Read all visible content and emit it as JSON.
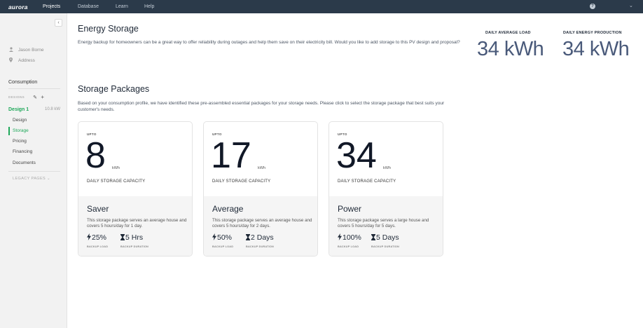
{
  "nav": {
    "logo": "aurora",
    "items": [
      {
        "label": "Projects"
      },
      {
        "label": "Database"
      },
      {
        "label": "Learn"
      },
      {
        "label": "Help"
      }
    ],
    "help_icon_glyph": "?",
    "dropdown_glyph": "⌄"
  },
  "sidebar": {
    "collapse_glyph": "‹",
    "customer_name": "Jason Borne",
    "address": "Address",
    "consumption": "Consumption",
    "designs_label": "DESIGNS",
    "design_name": "Design 1",
    "design_size": "10.8 kW",
    "items": [
      {
        "label": "Design"
      },
      {
        "label": "Storage"
      },
      {
        "label": "Pricing"
      },
      {
        "label": "Financing"
      },
      {
        "label": "Documents"
      }
    ],
    "legacy": "LEGACY PAGES  ⌄",
    "accent_color": "#1fa85a"
  },
  "header": {
    "title": "Energy Storage",
    "description": "Energy backup for homeowners can be a great way to offer reliability during outages and help them save on their electricity bill. Would you like to add storage to this PV design and proposal?"
  },
  "stats": [
    {
      "label": "DAILY AVERAGE LOAD",
      "value": "34 kWh"
    },
    {
      "label": "DAILY ENERGY PRODUCTION",
      "value": "34 kWh"
    }
  ],
  "packages_section": {
    "title": "Storage Packages",
    "description": "Based on your consumption profile, we have identified these pre-assembled essential packages for your storage needs. Please click to select the storage package that best suits your customer's needs."
  },
  "packages": [
    {
      "upto": "UPTO",
      "capacity": "8",
      "unit": "kWh",
      "capacity_label": "DAILY STORAGE CAPACITY",
      "name": "Saver",
      "description": "This storage package serves an average house and covers 5 hours/day for 1 day.",
      "backup_load": "25%",
      "backup_load_label": "BACKUP LOAD",
      "backup_duration": "5 Hrs",
      "backup_duration_label": "BACKUP DURATION"
    },
    {
      "upto": "UPTO",
      "capacity": "17",
      "unit": "kWh",
      "capacity_label": "DAILY STORAGE CAPACITY",
      "name": "Average",
      "description": "This storage package serves an average house and covers 5 hours/day for 2 days.",
      "backup_load": "50%",
      "backup_load_label": "BACKUP LOAD",
      "backup_duration": "2 Days",
      "backup_duration_label": "BACKUP DURATION"
    },
    {
      "upto": "UPTO",
      "capacity": "34",
      "unit": "kWh",
      "capacity_label": "DAILY STORAGE CAPACITY",
      "name": "Power",
      "description": "This storage package serves a large house and covers 5 hours/day for 5 days.",
      "backup_load": "100%",
      "backup_load_label": "BACKUP LOAD",
      "backup_duration": "5 Days",
      "backup_duration_label": "BACKUP DURATION"
    }
  ]
}
